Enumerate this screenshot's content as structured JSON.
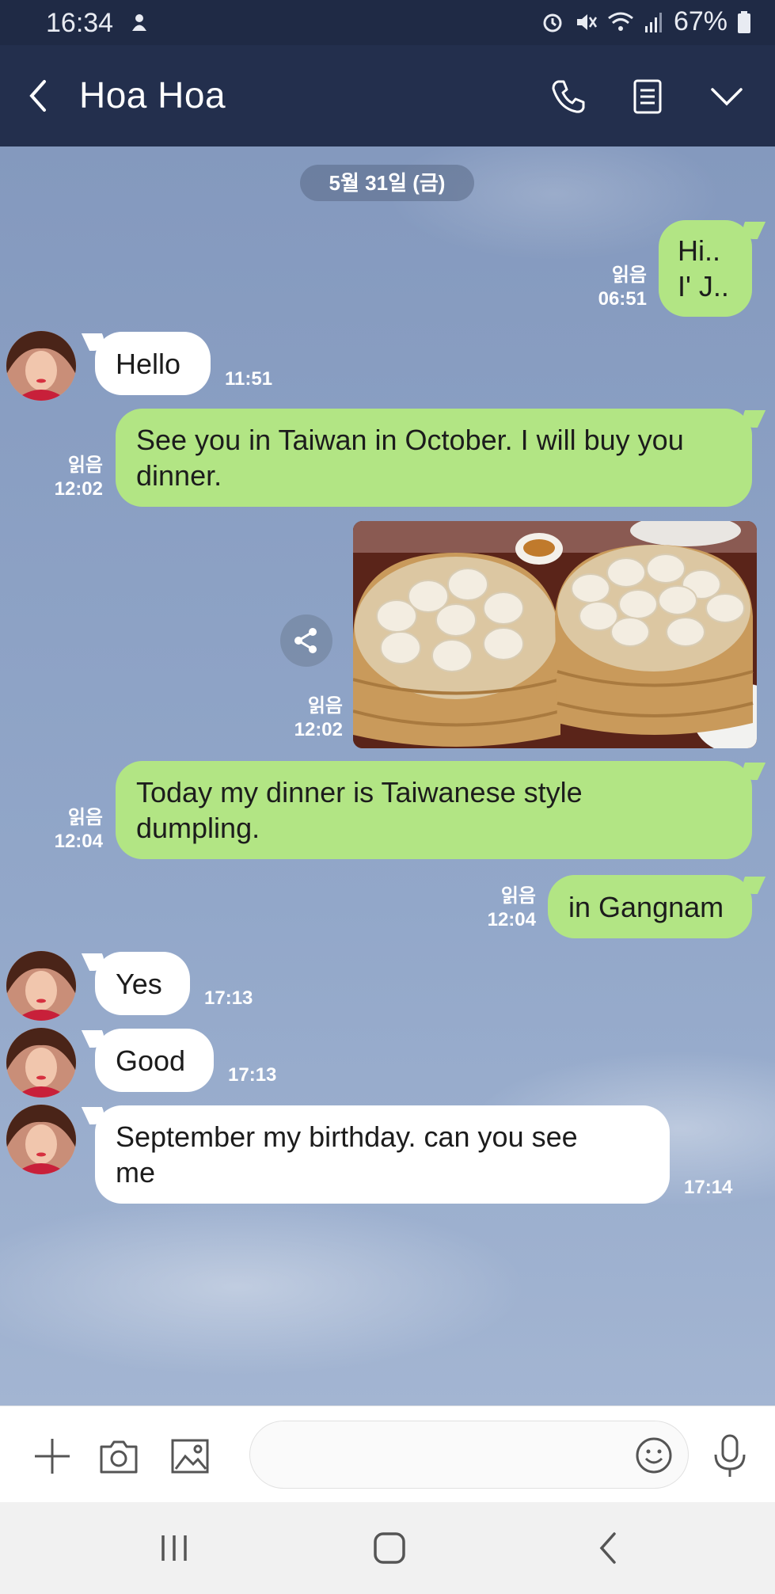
{
  "status_bar": {
    "time": "16:34",
    "battery": "67%"
  },
  "header": {
    "title": "Hoa Hoa"
  },
  "date_divider": "5월 31일 (금)",
  "messages": [
    {
      "side": "out",
      "lines": [
        "Hi..",
        "I' J.."
      ],
      "read": "읽음",
      "time": "06:51"
    },
    {
      "side": "in",
      "lines": [
        "Hello"
      ],
      "time": "11:51"
    },
    {
      "side": "out",
      "lines": [
        "See you in Taiwan in October. I will buy you",
        "dinner."
      ],
      "read": "읽음",
      "time": "12:02"
    },
    {
      "side": "out",
      "type": "image",
      "read": "읽음",
      "time": "12:02"
    },
    {
      "side": "out",
      "lines": [
        "Today my dinner is Taiwanese style",
        "dumpling."
      ],
      "read": "읽음",
      "time": "12:04"
    },
    {
      "side": "out",
      "lines": [
        "in Gangnam"
      ],
      "read": "읽음",
      "time": "12:04"
    },
    {
      "side": "in",
      "lines": [
        "Yes"
      ],
      "time": "17:13"
    },
    {
      "side": "in",
      "lines": [
        "Good"
      ],
      "time": "17:13"
    },
    {
      "side": "in",
      "lines": [
        "September my birthday.  can you see",
        "me"
      ],
      "time": "17:14"
    }
  ],
  "icons": {
    "header": [
      "back-chevron-icon",
      "phone-icon",
      "notes-icon",
      "chevron-down-icon"
    ],
    "input": [
      "plus-icon",
      "camera-icon",
      "image-icon",
      "emoji-icon",
      "microphone-icon"
    ],
    "nav": [
      "recent-apps-icon",
      "home-icon",
      "back-icon"
    ]
  },
  "colors": {
    "header_bg": "#232f4d",
    "outgoing_bubble": "#b2e584",
    "incoming_bubble": "#ffffff",
    "chat_bg": "#8aa0c4"
  }
}
